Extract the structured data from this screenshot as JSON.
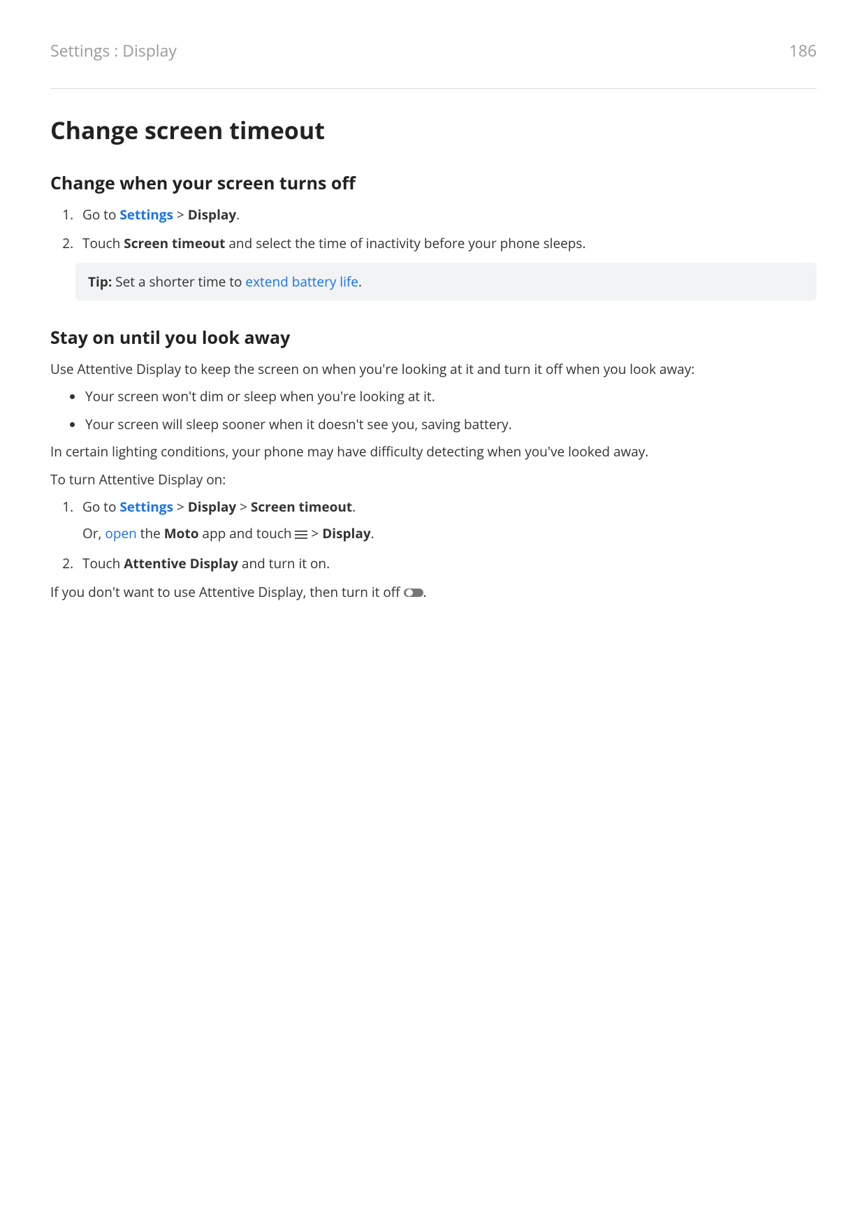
{
  "header": {
    "breadcrumb": "Settings : Display",
    "page_number": "186"
  },
  "title": "Change screen timeout",
  "section1": {
    "heading": "Change when your screen turns off",
    "step1": {
      "prefix": "Go to ",
      "link": "Settings",
      "sep": " > ",
      "bold": "Display",
      "suffix": "."
    },
    "step2": {
      "prefix": "Touch ",
      "bold": "Screen timeout",
      "suffix": " and select the time of inactivity before your phone sleeps."
    },
    "tip": {
      "label": "Tip:",
      "text": " Set a shorter time to ",
      "link": "extend battery life",
      "suffix": "."
    }
  },
  "section2": {
    "heading": "Stay on until you look away",
    "intro": "Use Attentive Display to keep the screen on when you're looking at it and turn it off when you look away:",
    "bullets": [
      "Your screen won't dim or sleep when you're looking at it.",
      "Your screen will sleep sooner when it doesn't see you, saving battery."
    ],
    "note": "In certain lighting conditions, your phone may have difficulty detecting when you've looked away.",
    "turn_on_label": "To turn Attentive Display on:",
    "step1": {
      "line1": {
        "prefix": "Go to ",
        "link": "Settings",
        "sep1": " > ",
        "bold1": "Display",
        "sep2": " > ",
        "bold2": "Screen timeout",
        "suffix": "."
      },
      "line2": {
        "prefix": "Or, ",
        "link": "open",
        "mid1": " the ",
        "bold1": "Moto",
        "mid2": " app and touch ",
        "sep": " > ",
        "bold2": "Display",
        "suffix": "."
      }
    },
    "step2": {
      "prefix": "Touch ",
      "bold": "Attentive Display",
      "suffix": " and turn it on."
    },
    "outro": {
      "prefix": "If you don't want to use Attentive Display, then turn it off ",
      "suffix": "."
    }
  }
}
